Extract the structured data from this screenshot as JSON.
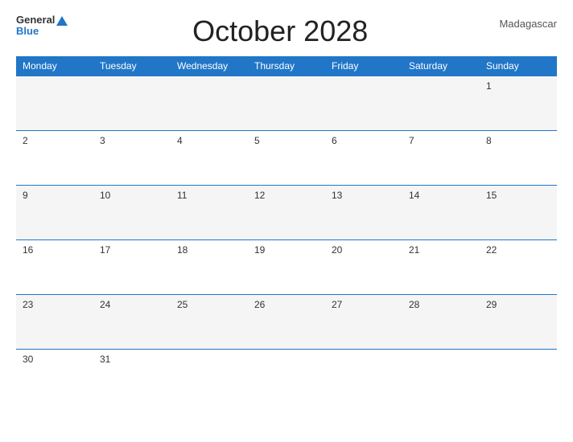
{
  "header": {
    "logo_general": "General",
    "logo_blue": "Blue",
    "title": "October 2028",
    "country": "Madagascar"
  },
  "weekdays": [
    "Monday",
    "Tuesday",
    "Wednesday",
    "Thursday",
    "Friday",
    "Saturday",
    "Sunday"
  ],
  "weeks": [
    [
      "",
      "",
      "",
      "",
      "",
      "",
      "1"
    ],
    [
      "2",
      "3",
      "4",
      "5",
      "6",
      "7",
      "8"
    ],
    [
      "9",
      "10",
      "11",
      "12",
      "13",
      "14",
      "15"
    ],
    [
      "16",
      "17",
      "18",
      "19",
      "20",
      "21",
      "22"
    ],
    [
      "23",
      "24",
      "25",
      "26",
      "27",
      "28",
      "29"
    ],
    [
      "30",
      "31",
      "",
      "",
      "",
      "",
      ""
    ]
  ]
}
